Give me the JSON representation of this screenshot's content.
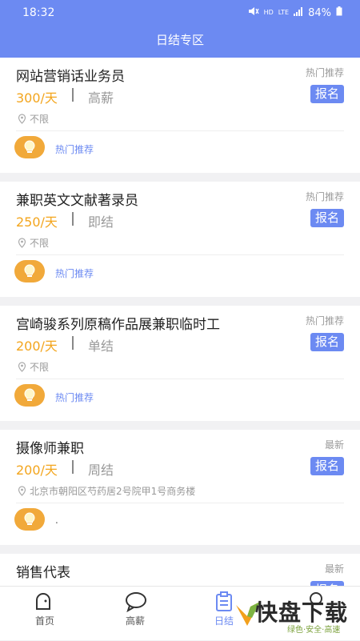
{
  "status_bar": {
    "time": "18:32",
    "hd": "HD",
    "lte": "LTE",
    "battery": "84%"
  },
  "header": {
    "title": "日结专区"
  },
  "jobs": [
    {
      "title": "网站营销话业务员",
      "tag": "热门推荐",
      "salary": "300/天",
      "benefit": "高薪",
      "apply_label": "报名",
      "location": "不限",
      "footer_label": "热门推荐"
    },
    {
      "title": "兼职英文文献著录员",
      "tag": "热门推荐",
      "salary": "250/天",
      "benefit": "即结",
      "apply_label": "报名",
      "location": "不限",
      "footer_label": "热门推荐"
    },
    {
      "title": "宫崎骏系列原稿作品展兼职临时工",
      "tag": "热门推荐",
      "salary": "200/天",
      "benefit": "单结",
      "apply_label": "报名",
      "location": "不限",
      "footer_label": "热门推荐"
    },
    {
      "title": "摄像师兼职",
      "tag": "最新",
      "salary": "200/天",
      "benefit": "周结",
      "apply_label": "报名",
      "location": "北京市朝阳区芍药居2号院甲1号商务楼",
      "footer_label": "."
    },
    {
      "title": "销售代表",
      "tag": "最新",
      "apply_label": "报名"
    }
  ],
  "tabbar": {
    "tabs": [
      {
        "label": "首页",
        "icon": "home-icon"
      },
      {
        "label": "高薪",
        "icon": "chat-icon"
      },
      {
        "label": "日结",
        "icon": "clipboard-icon"
      },
      {
        "label": "",
        "icon": "profile-icon"
      }
    ]
  },
  "watermark": {
    "brand": "快盘下载",
    "slogan": "绿色·安全·高速"
  },
  "colors": {
    "primary": "#6c8af2",
    "salary": "#f3a51d",
    "bulb": "#f1a93a"
  }
}
